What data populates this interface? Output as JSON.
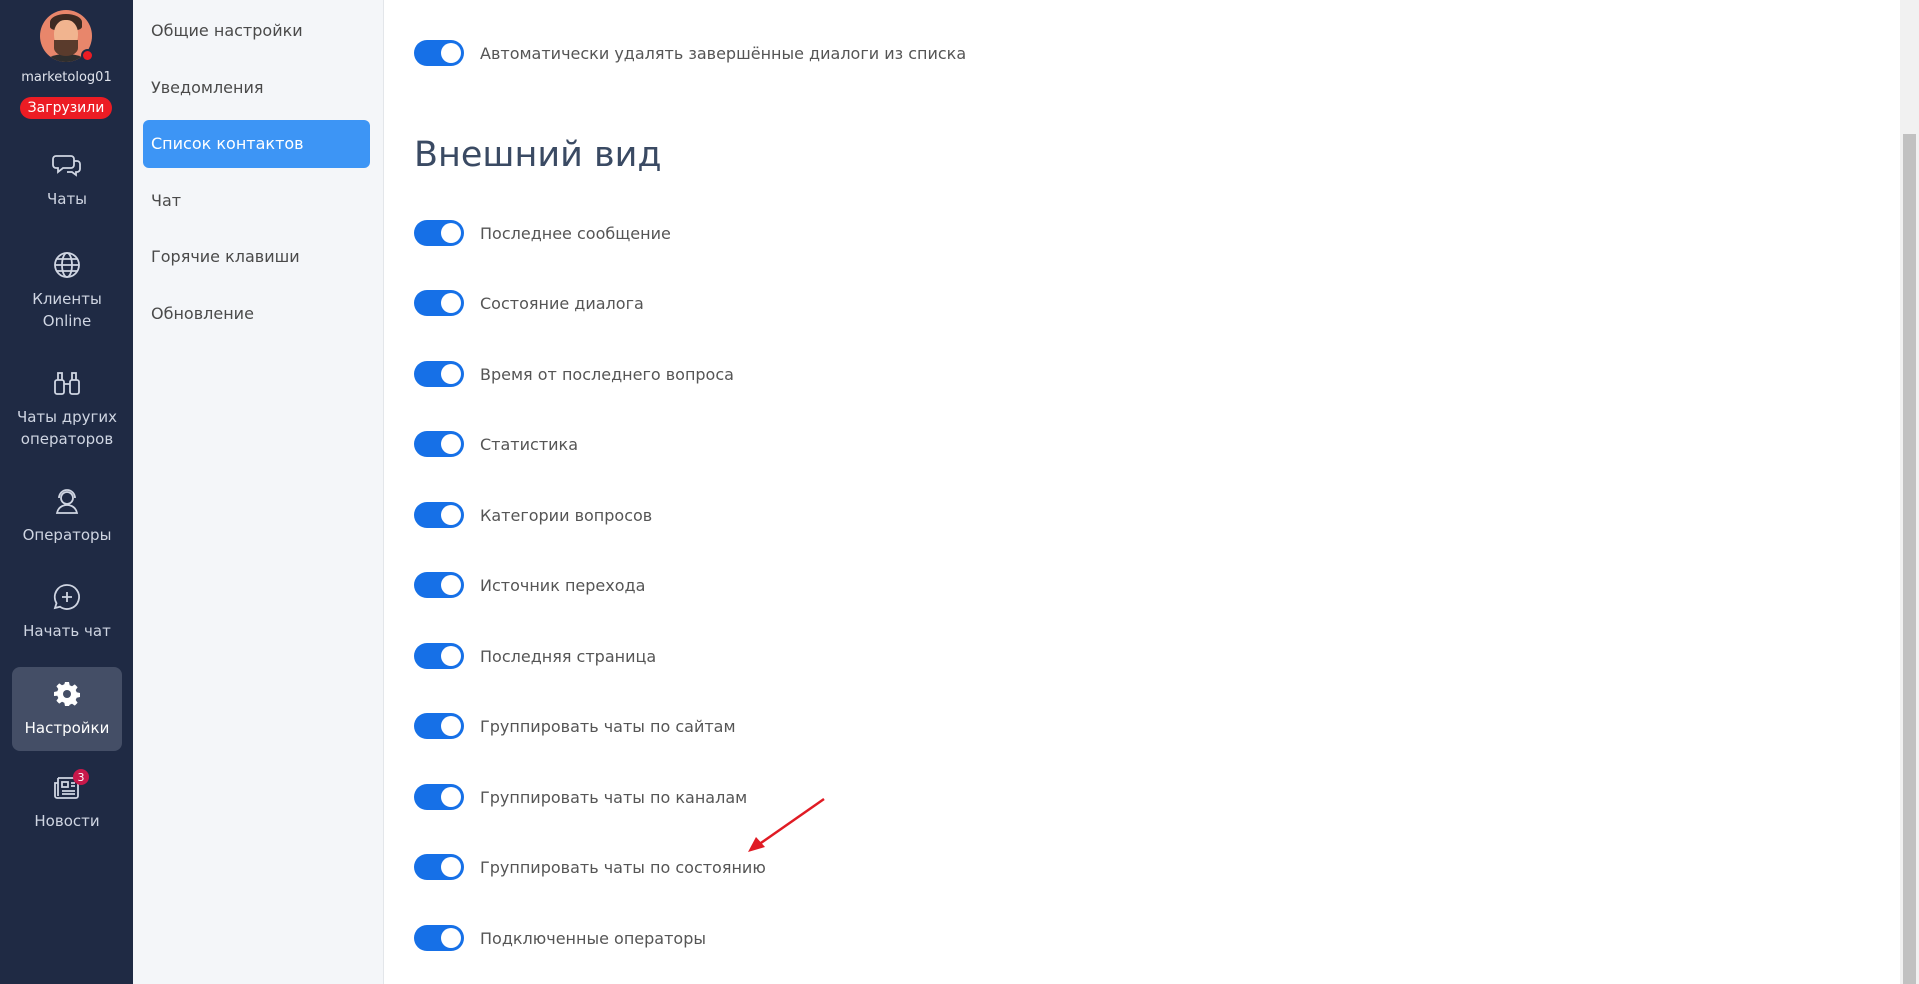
{
  "profile": {
    "username": "marketolog01",
    "status": "Загрузили",
    "status_color": "#ec1c24"
  },
  "nav": {
    "chats": "Чаты",
    "clients_line1": "Клиенты",
    "clients_line2": "Online",
    "others_line1": "Чаты других",
    "others_line2": "операторов",
    "operators": "Операторы",
    "start_chat": "Начать чат",
    "settings": "Настройки",
    "news": "Новости",
    "news_count": "3",
    "bg_color": "#1f2a44"
  },
  "submenu": {
    "items": [
      "Общие настройки",
      "Уведомления",
      "Список контактов",
      "Чат",
      "Горячие клавиши",
      "Обновление"
    ],
    "active": "Список контактов"
  },
  "main": {
    "top_toggle": "Автоматически удалять завершённые диалоги из списка",
    "appearance_title": "Внешний вид",
    "toggles": [
      "Последнее сообщение",
      "Состояние диалога",
      "Время от последнего вопроса",
      "Статистика",
      "Категории вопросов",
      "Источник перехода",
      "Последняя страница",
      "Группировать чаты по сайтам",
      "Группировать чаты по каналам",
      "Группировать чаты по состоянию",
      "Подключенные операторы"
    ],
    "toggle_state": "on",
    "toggle_color": "#1670e7",
    "accent_color": "#3d95f5"
  }
}
